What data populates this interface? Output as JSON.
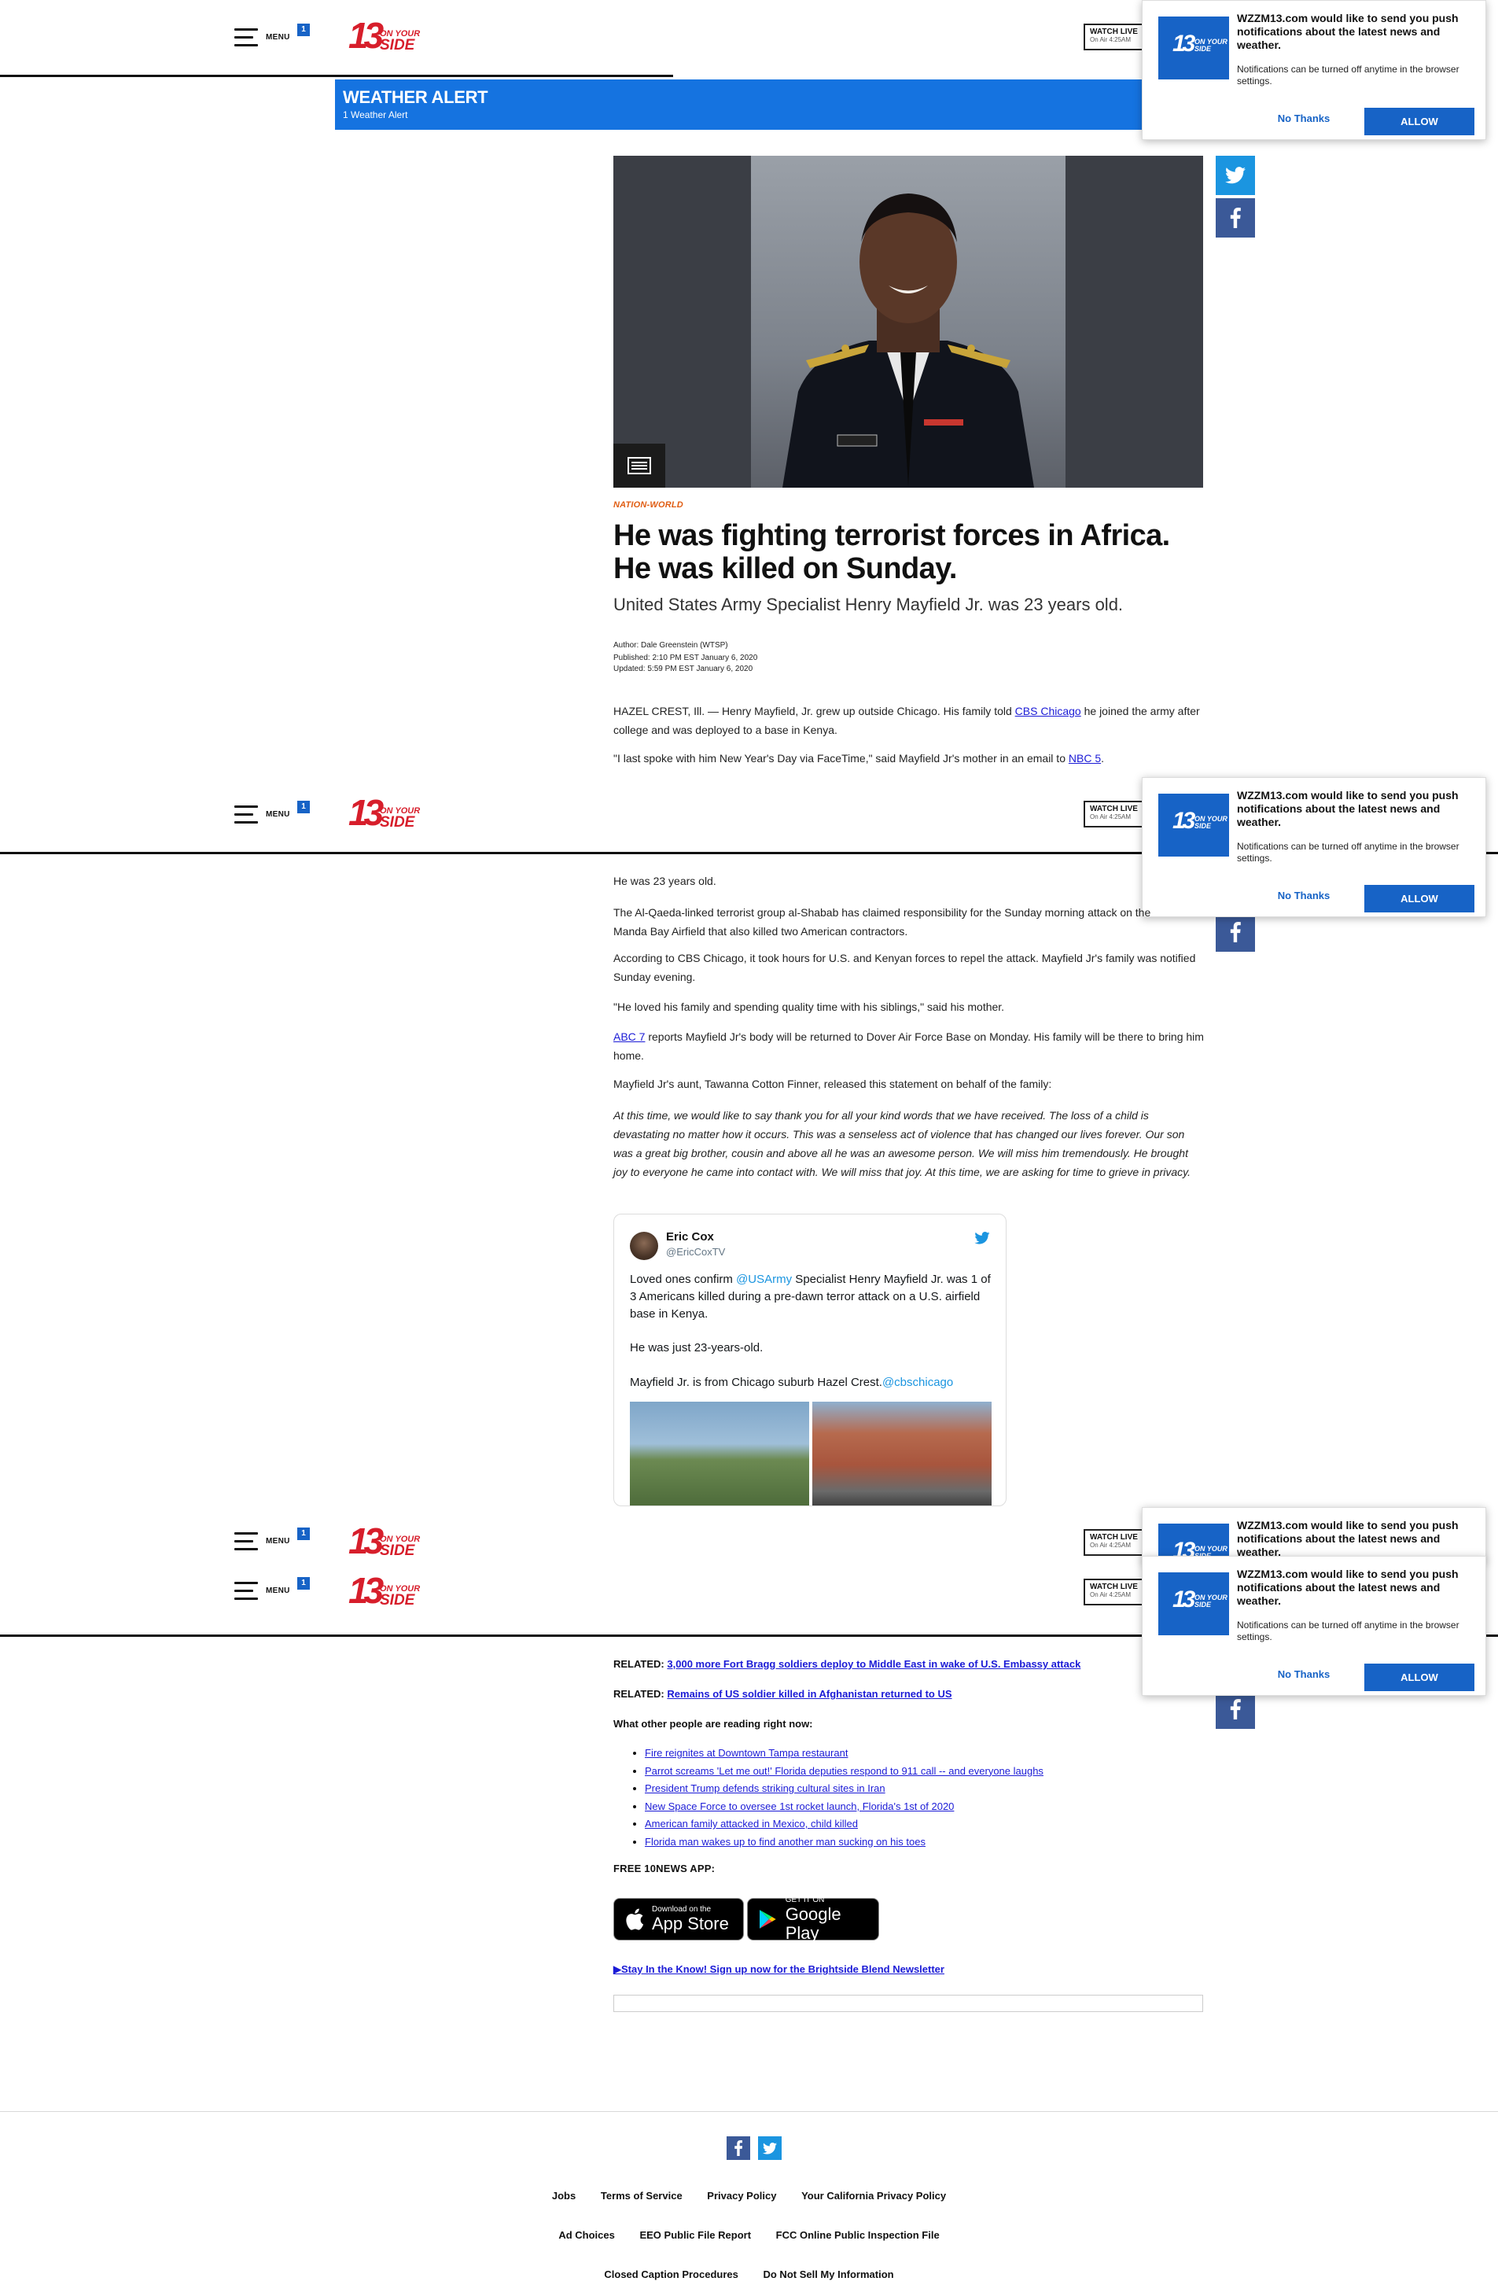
{
  "header": {
    "menu_label": "MENU",
    "alert_count": "1",
    "logo_number": "13",
    "logo_tag_top": "ON YOUR",
    "logo_tag_bottom": "SIDE",
    "watch_live": "WATCH LIVE",
    "on_air": "On Air 4:25AM"
  },
  "notification": {
    "logo_number": "13",
    "logo_tag": "ON YOUR SIDE",
    "title": "WZZM13.com would like to send you push notifications about the latest news and weather.",
    "body": "Notifications can be turned off anytime in the browser settings.",
    "no_thanks": "No Thanks",
    "allow": "ALLOW"
  },
  "weather_alert": {
    "title": "WEATHER ALERT",
    "subtitle": "1 Weather Alert"
  },
  "article": {
    "kicker": "NATION-WORLD",
    "headline": "He was fighting terrorist forces in Africa. He was killed on Sunday.",
    "subhead": "United States Army Specialist Henry Mayfield Jr. was 23 years old.",
    "author_label": "Author:",
    "author": "Dale Greenstein (WTSP)",
    "published_label": "Published:",
    "published": "2:10 PM EST January 6, 2020",
    "updated_label": "Updated:",
    "updated": "5:59 PM EST January 6, 2020",
    "p1_a": "HAZEL CREST, Ill. — Henry Mayfield, Jr. grew up outside Chicago. His family told ",
    "p1_link": "CBS Chicago",
    "p1_b": " he joined the army after college and was deployed to a base in Kenya.",
    "p2_a": "\"I last spoke with him New Year's Day via FaceTime,\" said Mayfield Jr's mother in an email to ",
    "p2_link": "NBC 5",
    "p2_b": ".",
    "p3": "He was 23 years old.",
    "p4": "The Al-Qaeda-linked terrorist group al-Shabab has claimed responsibility for the Sunday morning attack on the Manda Bay Airfield that also killed two American contractors.",
    "p5": "According to CBS Chicago, it took hours for U.S. and Kenyan forces to repel the attack. Mayfield Jr's family was notified Sunday evening.",
    "p6": "\"He loved his family and spending quality time with his siblings,\" said his mother.",
    "p7_link": "ABC 7",
    "p7_b": " reports Mayfield Jr's body will be returned to Dover Air Force Base on Monday. His family will be there to bring him home.",
    "p8": "Mayfield Jr's aunt, Tawanna Cotton Finner, released this statement on behalf of the family:",
    "quote": "At this time, we would like to say thank you for all your kind words that we have received. The loss of a child is devastating no matter how it occurs. This was a senseless act of violence that has changed our lives forever. Our son was a great big brother, cousin and above all he was an awesome person. We will miss him tremendously. He brought joy to everyone he came into contact with. We will miss that joy. At this time, we are asking for time to grieve in privacy."
  },
  "tweet": {
    "name": "Eric Cox",
    "handle": "@EricCoxTV",
    "t1_a": "Loved ones confirm ",
    "t1_link": "@USArmy",
    "t1_b": " Specialist Henry Mayfield Jr. was 1 of 3 Americans killed during a pre-dawn terror attack on a U.S. airfield base in Kenya.",
    "t2": "He was just 23-years-old.",
    "t3_a": "Mayfield Jr. is from Chicago suburb Hazel Crest.",
    "t3_link": "@cbschicago"
  },
  "related": [
    {
      "label": "RELATED:",
      "text": "3,000 more Fort Bragg soldiers deploy to Middle East in wake of U.S. Embassy attack"
    },
    {
      "label": "RELATED:",
      "text": "Remains of US soldier killed in Afghanistan returned to US"
    }
  ],
  "reading": {
    "heading": "What other people are reading right now:",
    "items": [
      "Fire reignites at Downtown Tampa restaurant",
      "Parrot screams 'Let me out!' Florida deputies respond to 911 call -- and everyone laughs",
      "President Trump defends striking cultural sites in Iran",
      "New Space Force to oversee 1st rocket launch, Florida's 1st of 2020",
      "American family attacked in Mexico, child killed",
      "Florida man wakes up to find another man sucking on his toes"
    ]
  },
  "app": {
    "heading": "FREE 10NEWS APP:",
    "appstore_small": "Download on the",
    "appstore_big": "App Store",
    "google_small": "GET IT ON",
    "google_big": "Google Play",
    "newsletter": "▶Stay In the Know! Sign up now for the Brightside Blend Newsletter"
  },
  "footer": {
    "row1": [
      "Jobs",
      "Terms of Service",
      "Privacy Policy",
      "Your California Privacy Policy"
    ],
    "row2": [
      "Ad Choices",
      "EEO Public File Report",
      "FCC Online Public Inspection File"
    ],
    "row3": [
      "Closed Caption Procedures",
      "Do Not Sell My Information"
    ]
  },
  "colors": {
    "brand_red": "#d71e2b",
    "brand_blue": "#1763c6",
    "alert_blue": "#1573e0",
    "kicker_orange": "#e05d13",
    "twitter_blue": "#1b95e0",
    "facebook_blue": "#3b5998"
  }
}
